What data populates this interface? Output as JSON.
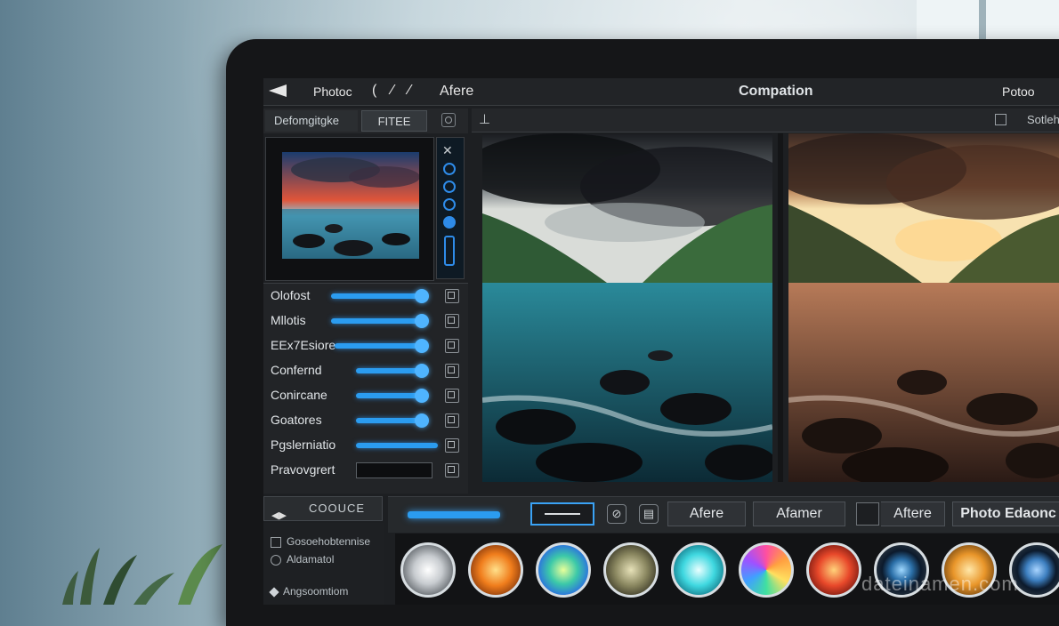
{
  "topbar": {
    "photo_label": "Photoc",
    "tools_label": "( ⁄ ⁄",
    "after_label": "Afere",
    "center_title": "Compation",
    "right_label": "Potoo"
  },
  "left_panel": {
    "tab_a": "Defomgitgke",
    "tab_b": "FITEE"
  },
  "adjustments": [
    {
      "label": "Olofost",
      "level": 0.95
    },
    {
      "label": "Mllotis",
      "level": 0.95
    },
    {
      "label": "EEx7Esiore",
      "level": 0.92
    },
    {
      "label": "Confernd",
      "level": 0.9
    },
    {
      "label": "Conircane",
      "level": 0.9
    },
    {
      "label": "Goatores",
      "level": 0.92
    },
    {
      "label": "Pgslerniatio",
      "level": 1.0
    },
    {
      "label": "Pravovgrert",
      "level": null
    }
  ],
  "left_bottom": {
    "button_label": "COOUCE",
    "item1": "Gosoehobtennise",
    "item2": "Aldamatol",
    "item3": "Angsoomtiom"
  },
  "canvas": {
    "right_label": "Sotleh"
  },
  "bottom_toolbar": {
    "btn1": "Afere",
    "btn2": "Afamer",
    "btn3": "Aftere",
    "btn4": "Photo Edaonc"
  },
  "swatches": [
    {
      "name": "silver",
      "color": "#c8ccd0"
    },
    {
      "name": "orange",
      "color": "#f07d1c"
    },
    {
      "name": "teal-green",
      "color": "#3cc9a8"
    },
    {
      "name": "olive",
      "color": "#8a8760"
    },
    {
      "name": "cyan",
      "color": "#3fd8e0"
    },
    {
      "name": "magenta",
      "color": "#d64fd0"
    },
    {
      "name": "red-orange",
      "color": "#e8482a"
    },
    {
      "name": "blue-lens",
      "color": "#2b6fa8"
    },
    {
      "name": "amber",
      "color": "#e9962a"
    },
    {
      "name": "blue-ring",
      "color": "#3d7fc0"
    }
  ],
  "watermark": "dateinamen.com",
  "colors": {
    "accent": "#2b9cf0",
    "panel": "#222427",
    "background": "#1d1f22"
  }
}
